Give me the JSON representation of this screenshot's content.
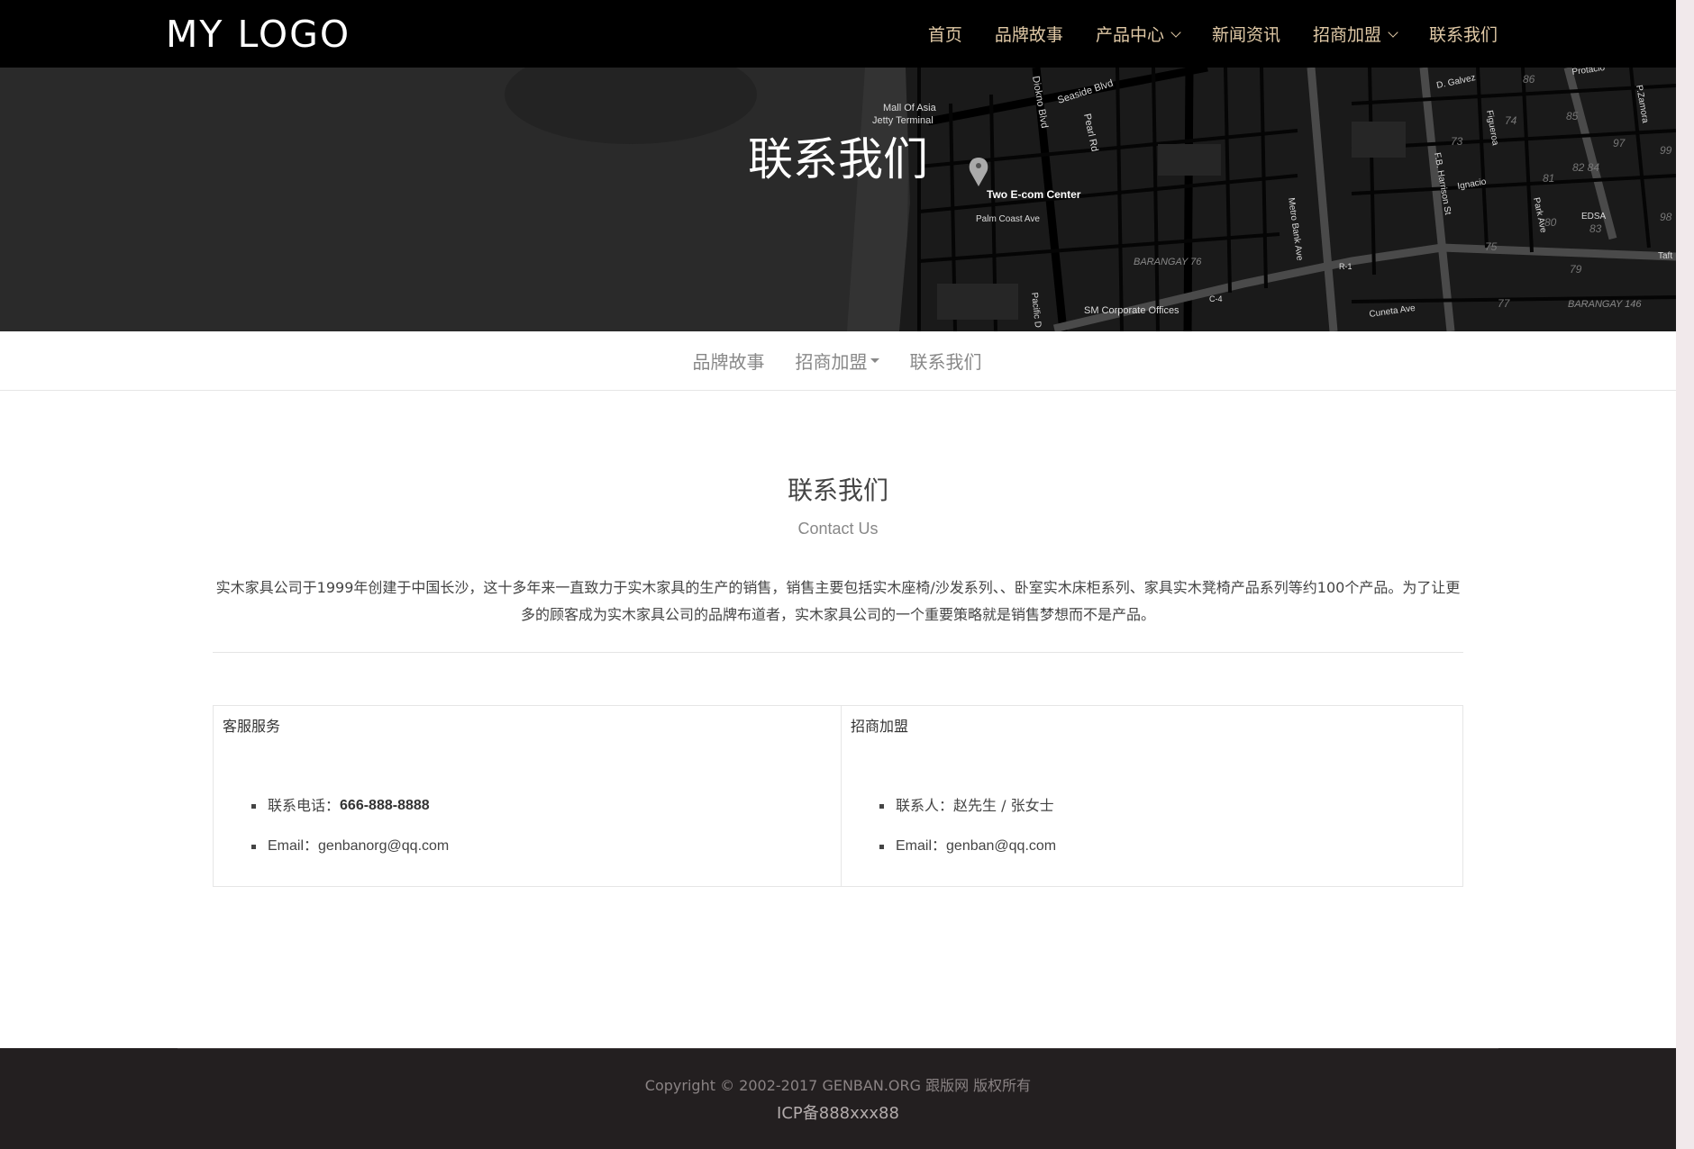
{
  "header": {
    "logo": "MY LOGO",
    "nav": [
      {
        "label": "首页"
      },
      {
        "label": "品牌故事"
      },
      {
        "label": "产品中心"
      },
      {
        "label": "新闻资讯"
      },
      {
        "label": "招商加盟"
      },
      {
        "label": "联系我们"
      }
    ]
  },
  "banner": {
    "title": "联系我们",
    "map_labels": {
      "l1": "Mall Of Asia",
      "l2": "Jetty Terminal",
      "l3": "Seaside Blvd",
      "l4": "Diokno Blvd",
      "l5": "Pearl Rd",
      "l6": "Two E-com Center",
      "l7": "Palm Coast Ave",
      "l8": "BARANGAY 76",
      "l9": "Metro Bank Ave",
      "l10": "SM Corporate Offices",
      "l11": "C-4",
      "l12": "Cuneta Ave",
      "l13": "F.B. Harrison St",
      "l14": "Ignacio",
      "l15": "D. Galvez",
      "l16": "Figueroa",
      "l17": "Park Ave",
      "l18": "EDSA",
      "l19": "BARANGAY 146",
      "l20": "Protacio",
      "l21": "P.Zamora",
      "l22": "R-1",
      "l23": "Pacific D",
      "l24": "Taft"
    },
    "map_numbers": {
      "n1": "86",
      "n2": "85",
      "n3": "74",
      "n4": "73",
      "n5": "97",
      "n6": "81",
      "n7": "82 84",
      "n8": "80",
      "n9": "83",
      "n10": "79",
      "n11": "77",
      "n12": "75",
      "n13": "98",
      "n14": "99"
    }
  },
  "subnav": {
    "items": [
      {
        "label": "品牌故事"
      },
      {
        "label": "招商加盟"
      },
      {
        "label": "联系我们"
      }
    ]
  },
  "main": {
    "title": "联系我们",
    "subtitle": "Contact Us",
    "intro_line1": "实木家具公司于1999年创建于中国长沙，这十多年来一直致力于实木家具的生产的销售，销售主要包括实木座椅/沙发系列、、卧室实木床柜系列、家具实木凳椅产品系列等约100个产品。为了让更",
    "intro_line2": "多的顾客成为实木家具公司的品牌布道者，实木家具公司的一个重要策略就是销售梦想而不是产品。",
    "service": {
      "title": "客服服务",
      "phone_label": "联系电话：",
      "phone": "666-888-8888",
      "email_label": "Email：",
      "email": "genbanorg@qq.com"
    },
    "franchise": {
      "title": "招商加盟",
      "contact_label": "联系人：",
      "contact": "赵先生 / 张女士",
      "email_label": "Email：",
      "email": "genban@qq.com"
    }
  },
  "footer": {
    "copyright": "Copyright © 2002-2017 GENBAN.ORG 跟版网 版权所有",
    "icp": "ICP备888xxx88"
  }
}
